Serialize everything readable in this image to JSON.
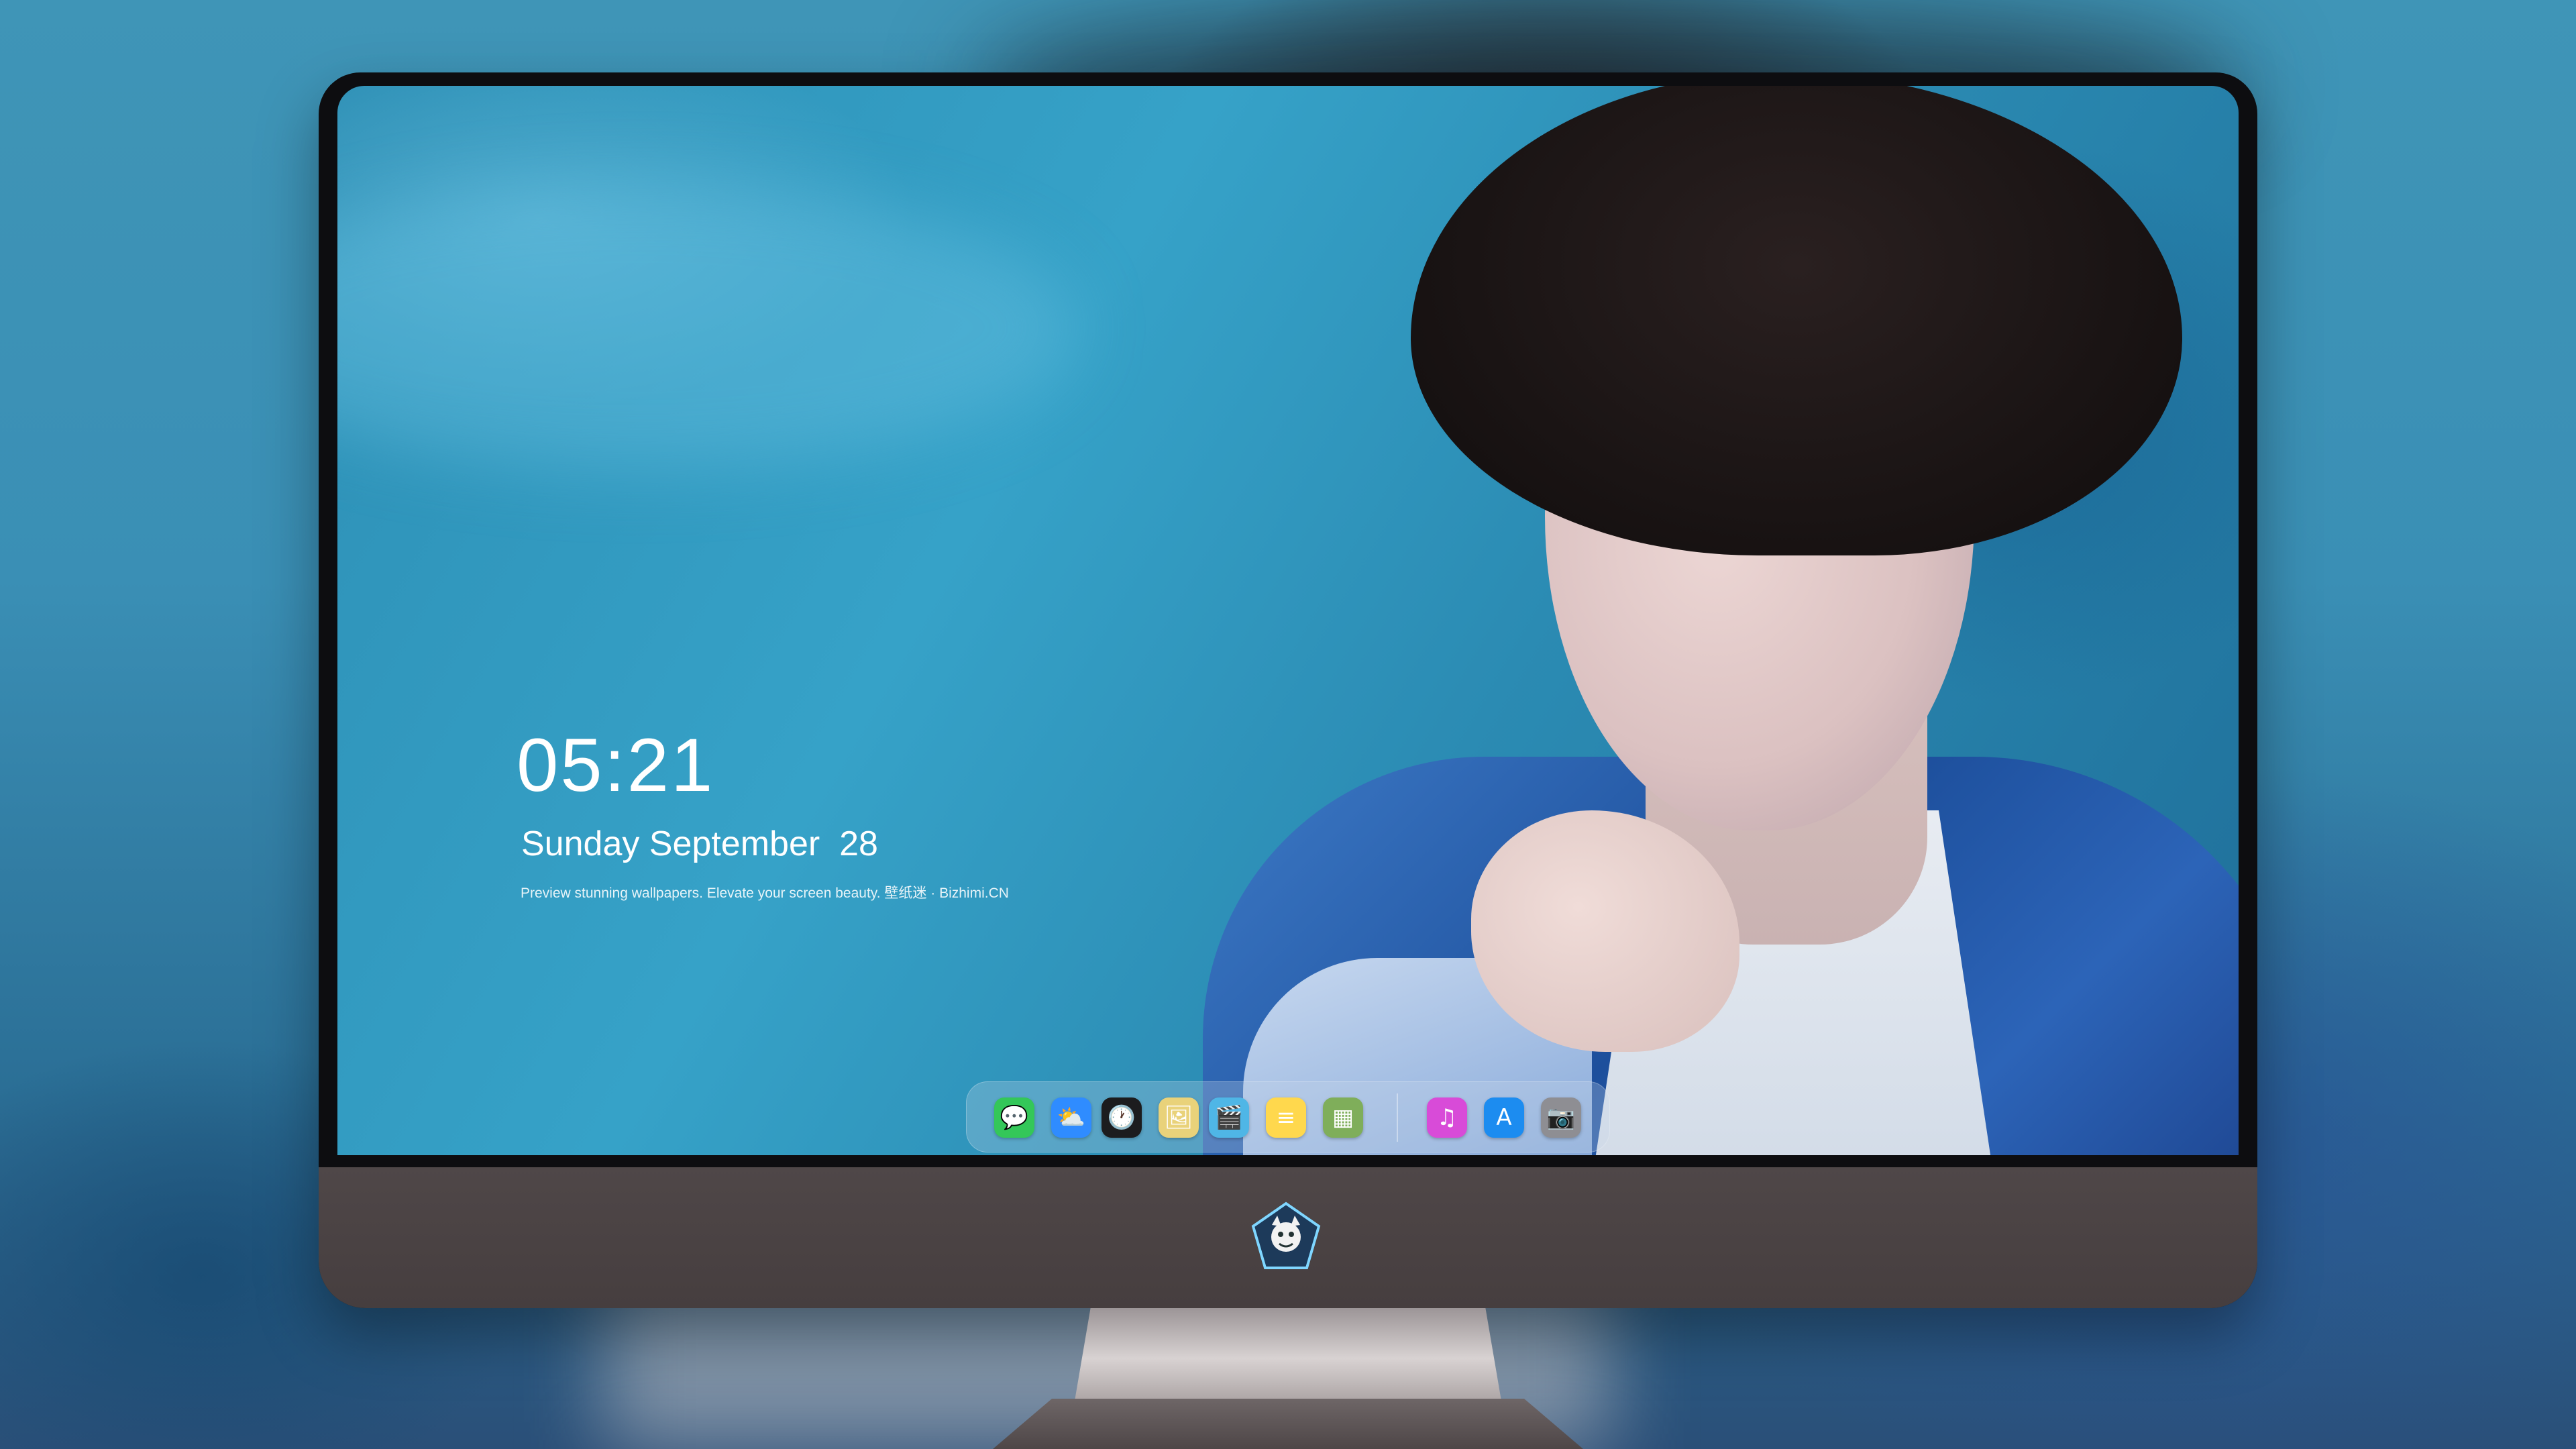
{
  "lock_screen": {
    "time": "05:21",
    "date": "Sunday September  28",
    "promo_text": "Preview stunning wallpapers. Elevate your screen beauty. 壁纸迷 · Bizhimi.CN"
  },
  "dock": {
    "apps": [
      {
        "name": "Messages",
        "icon": "messages-icon",
        "glyph": "💬",
        "color": "#34c759"
      },
      {
        "name": "Weather",
        "icon": "weather-icon",
        "glyph": "⛅",
        "color": "#2f8cff"
      },
      {
        "name": "Clock",
        "icon": "clock-icon",
        "glyph": "🕐",
        "color": "#1c1c1e"
      },
      {
        "name": "Preview",
        "icon": "preview-icon",
        "glyph": "🖼",
        "color": "#e9d27a"
      },
      {
        "name": "Clips",
        "icon": "clapperboard-icon",
        "glyph": "🎬",
        "color": "#4fb6e6"
      },
      {
        "name": "Notes",
        "icon": "notes-icon",
        "glyph": "≡",
        "color": "#ffd84d"
      },
      {
        "name": "Photo Booth",
        "icon": "gallery-icon",
        "glyph": "▦",
        "color": "#7fae5a"
      },
      {
        "name": "iTunes",
        "icon": "music-icon",
        "glyph": "♫",
        "color": "#d84bd8"
      },
      {
        "name": "App Store",
        "icon": "app-store-icon",
        "glyph": "A",
        "color": "#1c8cf0"
      },
      {
        "name": "Camera",
        "icon": "camera-icon",
        "glyph": "📷",
        "color": "#8e8e93"
      }
    ]
  },
  "colors": {
    "background": "#3a8fb5",
    "bezel": "#0d0d10",
    "chin": "#4b4344",
    "stand": "#bdb6b6",
    "text": "#ffffff"
  }
}
